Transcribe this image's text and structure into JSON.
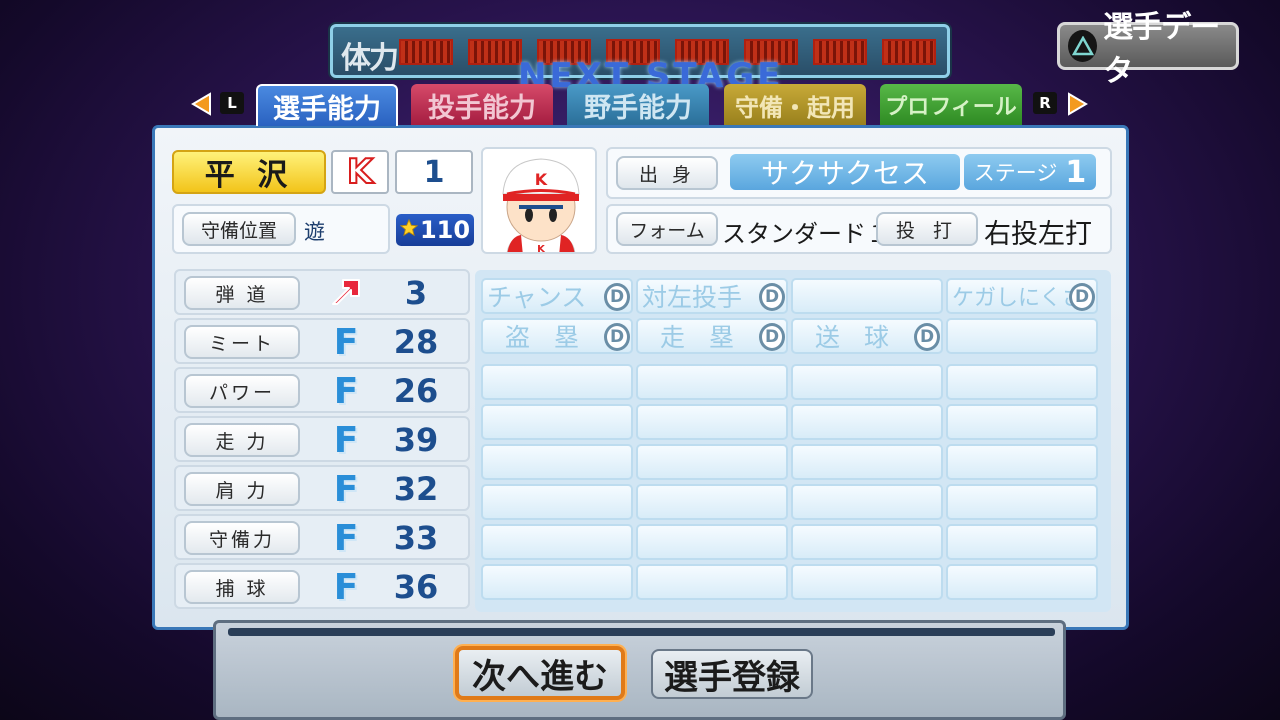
{
  "stamina": {
    "label": "体力",
    "segments": 8,
    "subtitle": "NEXT STAGE"
  },
  "player_data_button": {
    "label": "選手データ",
    "icon": "triangle-icon"
  },
  "nav": {
    "left_key": "L",
    "right_key": "R",
    "tabs": [
      {
        "label": "選手能力",
        "color": "#2a62c0",
        "active": true
      },
      {
        "label": "投手能力",
        "color": "#b42048"
      },
      {
        "label": "野手能力",
        "color": "#2c7aa4"
      },
      {
        "label": "守備・起用",
        "color": "#a48820"
      },
      {
        "label": "プロフィール",
        "color": "#3a9a2a"
      }
    ]
  },
  "player": {
    "name": "平 沢",
    "team_logo": "K",
    "number": "1",
    "position_label": "守備位置",
    "position": "遊",
    "rating": "110",
    "origin_label": "出 身",
    "origin": "サクサクセス",
    "stage_label": "ステージ",
    "stage_num": "1",
    "form_label": "フォーム",
    "form": "スタンダード１",
    "bat_throw_label": "投 打",
    "bat_throw": "右投左打"
  },
  "stats": [
    {
      "label": "弾 道",
      "grade": "",
      "value": "3",
      "arrow": true
    },
    {
      "label": "ミート",
      "grade": "F",
      "value": "28"
    },
    {
      "label": "パワー",
      "grade": "F",
      "value": "26"
    },
    {
      "label": "走 力",
      "grade": "F",
      "value": "39"
    },
    {
      "label": "肩 力",
      "grade": "F",
      "value": "32"
    },
    {
      "label": "守備力",
      "grade": "F",
      "value": "33"
    },
    {
      "label": "捕 球",
      "grade": "F",
      "value": "36"
    }
  ],
  "abilities": [
    {
      "label": "チャンス",
      "grade": "D"
    },
    {
      "label": "対左投手",
      "grade": "D"
    },
    {
      "label": "",
      "grade": ""
    },
    {
      "label": "ケガしにくさ",
      "grade": "D"
    },
    {
      "label": "盗 塁",
      "grade": "D"
    },
    {
      "label": "走 塁",
      "grade": "D"
    },
    {
      "label": "送 球",
      "grade": "D"
    },
    {
      "label": "",
      "grade": ""
    }
  ],
  "bottom": {
    "next_button": "次へ進む",
    "register_button": "選手登録"
  },
  "colors": {
    "grade_f": "#2a8ed8",
    "value": "#1d4e8e",
    "name_bg": "#f8d020",
    "accent_orange": "#e07a18"
  }
}
